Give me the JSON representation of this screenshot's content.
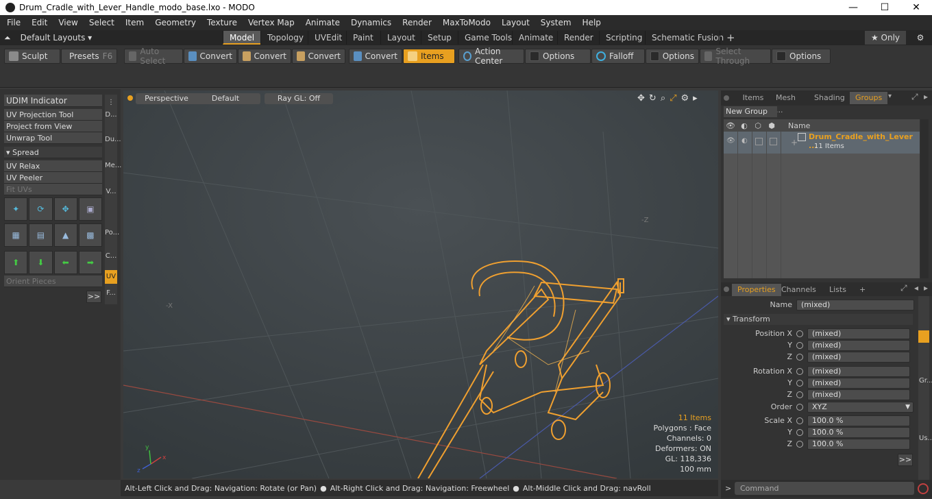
{
  "window": {
    "title": "Drum_Cradle_with_Lever_Handle_modo_base.lxo - MODO",
    "minimize": "—",
    "maximize": "☐",
    "close": "✕"
  },
  "menu": [
    "File",
    "Edit",
    "View",
    "Select",
    "Item",
    "Geometry",
    "Texture",
    "Vertex Map",
    "Animate",
    "Dynamics",
    "Render",
    "MaxToModo",
    "Layout",
    "System",
    "Help"
  ],
  "layout_selector": "Default Layouts ▾",
  "tabs": [
    "Model",
    "Topology",
    "UVEdit",
    "Paint",
    "Layout",
    "Setup",
    "Game Tools",
    "Animate",
    "Render",
    "Scripting",
    "Schematic Fusion",
    "+"
  ],
  "only_label": "★  Only",
  "toolbar": {
    "sculpt": "Sculpt",
    "presets": "Presets",
    "presets_key": "F6",
    "auto_select": "Auto Select",
    "convert1": "Convert",
    "convert2": "Convert",
    "convert3": "Convert",
    "convert4": "Convert",
    "items": "Items",
    "action_center": "Action Center",
    "options1": "Options",
    "falloff": "Falloff",
    "options2": "Options",
    "select_through": "Select Through",
    "options3": "Options"
  },
  "left": {
    "udim": "UDIM Indicator",
    "uv_projection": "UV Projection Tool",
    "project_view": "Project from View",
    "unwrap": "Unwrap Tool",
    "spread": "▾  Spread",
    "uv_relax": "UV Relax",
    "uv_peeler": "UV Peeler",
    "fit_uvs": "Fit UVs",
    "orient": "Orient Pieces",
    "more": ">>",
    "vtabs": [
      "D...",
      "Du...",
      "Me...",
      "V...",
      "Po...",
      "C...",
      "UV",
      "F..."
    ]
  },
  "viewport": {
    "view": "Perspective",
    "shading": "Default",
    "raygl": "Ray GL: Off",
    "info": {
      "items": "11 Items",
      "polygons": "Polygons : Face",
      "channels": "Channels: 0",
      "deformers": "Deformers: ON",
      "gl": "GL: 118,336",
      "scale": "100 mm"
    }
  },
  "status": {
    "a": "Alt-Left Click and Drag: Navigation: Rotate (or Pan)",
    "b": "Alt-Right Click and Drag: Navigation: Freewheel",
    "c": "Alt-Middle Click and Drag: navRoll"
  },
  "right": {
    "tabs": [
      "Items",
      "Mesh ...",
      "Shading",
      "Groups"
    ],
    "new_group": "New Group",
    "col_name": "Name",
    "group_name": "Drum_Cradle_with_Lever ...",
    "group_count": "11 Items",
    "ptabs": [
      "Properties",
      "Channels",
      "Lists",
      "+"
    ],
    "name_label": "Name",
    "name_val": "(mixed)",
    "transform": "▾  Transform",
    "posx": "Position X",
    "y": "Y",
    "z": "Z",
    "rotx": "Rotation X",
    "order": "Order",
    "order_val": "XYZ",
    "scalex": "Scale X",
    "mixed": "(mixed)",
    "pct": "100.0 %",
    "more": ">>",
    "side": [
      "Gr...",
      "Us..."
    ],
    "command": "Command"
  }
}
